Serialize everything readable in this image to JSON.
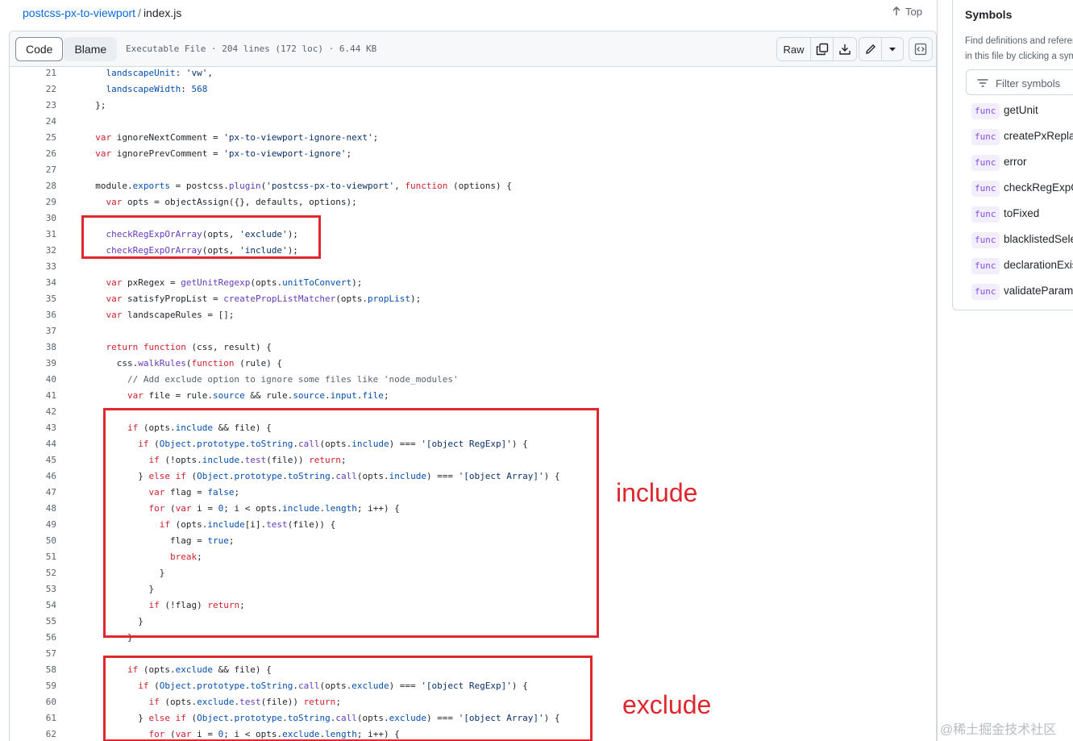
{
  "breadcrumb": {
    "repo": "postcss-px-to-viewport",
    "separator": "/",
    "file": "index.js"
  },
  "top_link": "Top",
  "toolbar": {
    "code_tab": "Code",
    "blame_tab": "Blame",
    "meta": "Executable File · 204 lines (172 loc) · 6.44 KB",
    "raw_label": "Raw"
  },
  "code_lines": [
    {
      "n": "21",
      "html": "    <span class=\"p\">landscapeUnit</span>: <span class=\"s\">'vw'</span>,"
    },
    {
      "n": "22",
      "html": "    <span class=\"p\">landscapeWidth</span>: <span class=\"p\">568</span>"
    },
    {
      "n": "23",
      "html": "  };"
    },
    {
      "n": "24",
      "html": ""
    },
    {
      "n": "25",
      "html": "  <span class=\"k\">var</span> ignoreNextComment = <span class=\"s\">'px-to-viewport-ignore-next'</span>;"
    },
    {
      "n": "26",
      "html": "  <span class=\"k\">var</span> ignorePrevComment = <span class=\"s\">'px-to-viewport-ignore'</span>;"
    },
    {
      "n": "27",
      "html": ""
    },
    {
      "n": "28",
      "html": "  module.<span class=\"p\">exports</span> = postcss.<span class=\"f\">plugin</span>(<span class=\"s\">'postcss-px-to-viewport'</span>, <span class=\"k\">function</span> (options) {"
    },
    {
      "n": "29",
      "html": "    <span class=\"k\">var</span> opts = objectAssign({}, defaults, options);"
    },
    {
      "n": "30",
      "html": ""
    },
    {
      "n": "31",
      "html": "    <span class=\"f\">checkRegExpOrArray</span>(opts, <span class=\"s\">'exclude'</span>);"
    },
    {
      "n": "32",
      "html": "    <span class=\"f\">checkRegExpOrArray</span>(opts, <span class=\"s\">'include'</span>);"
    },
    {
      "n": "33",
      "html": ""
    },
    {
      "n": "34",
      "html": "    <span class=\"k\">var</span> pxRegex = <span class=\"f\">getUnitRegexp</span>(opts.<span class=\"p\">unitToConvert</span>);"
    },
    {
      "n": "35",
      "html": "    <span class=\"k\">var</span> satisfyPropList = <span class=\"f\">createPropListMatcher</span>(opts.<span class=\"p\">propList</span>);"
    },
    {
      "n": "36",
      "html": "    <span class=\"k\">var</span> landscapeRules = [];"
    },
    {
      "n": "37",
      "html": ""
    },
    {
      "n": "38",
      "html": "    <span class=\"k\">return</span> <span class=\"k\">function</span> (css, result) {"
    },
    {
      "n": "39",
      "html": "      css.<span class=\"f\">walkRules</span>(<span class=\"k\">function</span> (rule) {"
    },
    {
      "n": "40",
      "html": "        <span class=\"c\">// Add exclude option to ignore some files like 'node_modules'</span>"
    },
    {
      "n": "41",
      "html": "        <span class=\"k\">var</span> file = rule.<span class=\"p\">source</span> &amp;&amp; rule.<span class=\"p\">source</span>.<span class=\"p\">input</span>.<span class=\"p\">file</span>;"
    },
    {
      "n": "42",
      "html": ""
    },
    {
      "n": "43",
      "html": "        <span class=\"k\">if</span> (opts.<span class=\"p\">include</span> &amp;&amp; file) {"
    },
    {
      "n": "44",
      "html": "          <span class=\"k\">if</span> (<span class=\"p\">Object</span>.<span class=\"p\">prototype</span>.<span class=\"p\">toString</span>.<span class=\"f\">call</span>(opts.<span class=\"p\">include</span>) === <span class=\"s\">'[object RegExp]'</span>) {"
    },
    {
      "n": "45",
      "html": "            <span class=\"k\">if</span> (!opts.<span class=\"p\">include</span>.<span class=\"f\">test</span>(file)) <span class=\"k\">return</span>;"
    },
    {
      "n": "46",
      "html": "          } <span class=\"k\">else</span> <span class=\"k\">if</span> (<span class=\"p\">Object</span>.<span class=\"p\">prototype</span>.<span class=\"p\">toString</span>.<span class=\"f\">call</span>(opts.<span class=\"p\">include</span>) === <span class=\"s\">'[object Array]'</span>) {"
    },
    {
      "n": "47",
      "html": "            <span class=\"k\">var</span> flag = <span class=\"p\">false</span>;"
    },
    {
      "n": "48",
      "html": "            <span class=\"k\">for</span> (<span class=\"k\">var</span> i = <span class=\"p\">0</span>; i &lt; opts.<span class=\"p\">include</span>.<span class=\"p\">length</span>; i++) {"
    },
    {
      "n": "49",
      "html": "              <span class=\"k\">if</span> (opts.<span class=\"p\">include</span>[i].<span class=\"f\">test</span>(file)) {"
    },
    {
      "n": "50",
      "html": "                flag = <span class=\"p\">true</span>;"
    },
    {
      "n": "51",
      "html": "                <span class=\"k\">break</span>;"
    },
    {
      "n": "52",
      "html": "              }"
    },
    {
      "n": "53",
      "html": "            }"
    },
    {
      "n": "54",
      "html": "            <span class=\"k\">if</span> (!flag) <span class=\"k\">return</span>;"
    },
    {
      "n": "55",
      "html": "          }"
    },
    {
      "n": "56",
      "html": "        }"
    },
    {
      "n": "57",
      "html": ""
    },
    {
      "n": "58",
      "html": "        <span class=\"k\">if</span> (opts.<span class=\"p\">exclude</span> &amp;&amp; file) {"
    },
    {
      "n": "59",
      "html": "          <span class=\"k\">if</span> (<span class=\"p\">Object</span>.<span class=\"p\">prototype</span>.<span class=\"p\">toString</span>.<span class=\"f\">call</span>(opts.<span class=\"p\">exclude</span>) === <span class=\"s\">'[object RegExp]'</span>) {"
    },
    {
      "n": "60",
      "html": "            <span class=\"k\">if</span> (opts.<span class=\"p\">exclude</span>.<span class=\"f\">test</span>(file)) <span class=\"k\">return</span>;"
    },
    {
      "n": "61",
      "html": "          } <span class=\"k\">else</span> <span class=\"k\">if</span> (<span class=\"p\">Object</span>.<span class=\"p\">prototype</span>.<span class=\"p\">toString</span>.<span class=\"f\">call</span>(opts.<span class=\"p\">exclude</span>) === <span class=\"s\">'[object Array]'</span>) {"
    },
    {
      "n": "62",
      "html": "            <span class=\"k\">for</span> (<span class=\"k\">var</span> i = <span class=\"p\">0</span>; i &lt; opts.<span class=\"p\">exclude</span>.<span class=\"p\">length</span>; i++) {"
    }
  ],
  "annotations": {
    "include_label": "include",
    "exclude_label": "exclude"
  },
  "symbols": {
    "title": "Symbols",
    "desc_line1": "Find definitions and references",
    "desc_line2": "in this file by clicking a symbol",
    "filter_placeholder": "Filter symbols",
    "items": [
      {
        "kind": "func",
        "name": "getUnit"
      },
      {
        "kind": "func",
        "name": "createPxReplace"
      },
      {
        "kind": "func",
        "name": "error"
      },
      {
        "kind": "func",
        "name": "checkRegExpOrArray"
      },
      {
        "kind": "func",
        "name": "toFixed"
      },
      {
        "kind": "func",
        "name": "blacklistedSelector"
      },
      {
        "kind": "func",
        "name": "declarationExists"
      },
      {
        "kind": "func",
        "name": "validateParams"
      }
    ]
  },
  "watermark": "@稀土掘金技术社区"
}
